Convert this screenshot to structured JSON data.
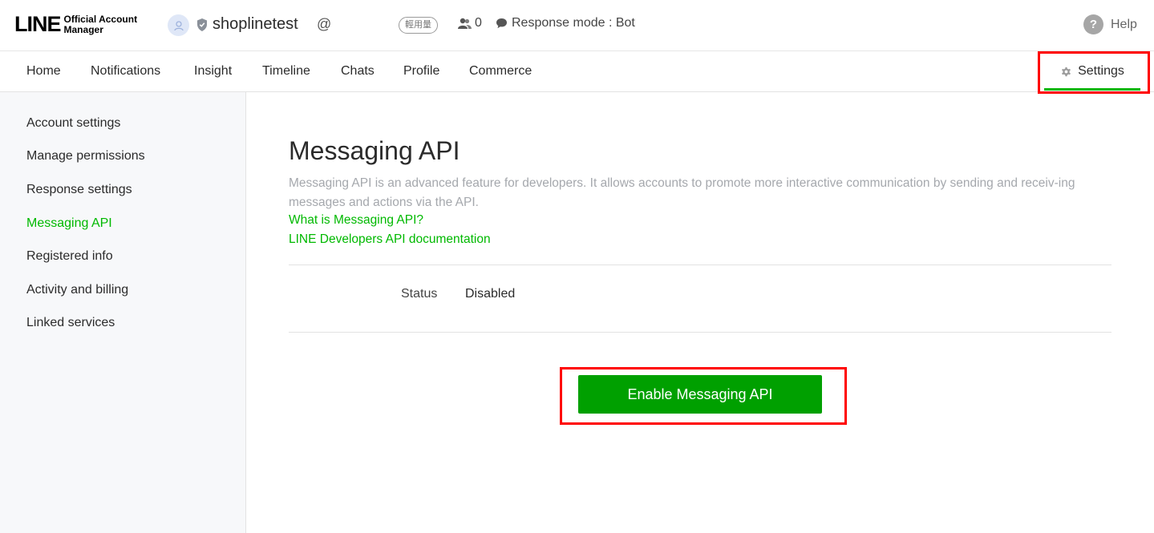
{
  "header": {
    "logo_main": "LINE",
    "logo_sub_line1": "Official Account",
    "logo_sub_line2": "Manager",
    "account_name": "shoplinetest",
    "account_at": "@",
    "plan_badge": "輕用量",
    "friend_count": "0",
    "response_mode": "Response mode : Bot",
    "help_label": "Help",
    "help_glyph": "?"
  },
  "nav": {
    "items": [
      "Home",
      "Notifications",
      "Insight",
      "Timeline",
      "Chats",
      "Profile",
      "Commerce"
    ],
    "settings_label": "Settings"
  },
  "sidebar": {
    "items": [
      {
        "label": "Account settings",
        "active": false
      },
      {
        "label": "Manage permissions",
        "active": false
      },
      {
        "label": "Response settings",
        "active": false
      },
      {
        "label": "Messaging API",
        "active": true
      },
      {
        "label": "Registered info",
        "active": false
      },
      {
        "label": "Activity and billing",
        "active": false
      },
      {
        "label": "Linked services",
        "active": false
      }
    ]
  },
  "main": {
    "title": "Messaging API",
    "description": "Messaging API is an advanced feature for developers. It allows accounts to promote more interactive communication by sending and receiv-ing messages and actions via the API.",
    "link_what": "What is Messaging API?",
    "link_docs": "LINE Developers API documentation",
    "status_label": "Status",
    "status_value": "Disabled",
    "enable_button": "Enable Messaging API"
  },
  "colors": {
    "accent_green": "#00b900",
    "button_green": "#00a000",
    "highlight_red": "#ff0000"
  }
}
